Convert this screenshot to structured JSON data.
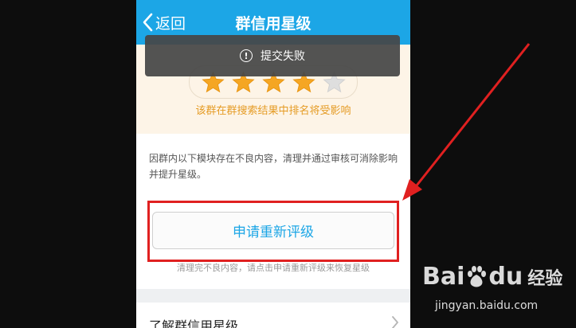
{
  "header": {
    "back_label": "返回",
    "title": "群信用星级"
  },
  "rating": {
    "stars_total": 5,
    "stars_filled": 4,
    "note": "该群在群搜索结果中排名将受影响",
    "star_color": "#f5a623",
    "star_empty_color": "#dedede"
  },
  "toast": {
    "message": "提交失败",
    "icon": "exclamation-circle-icon"
  },
  "content": {
    "description": "因群内以下模块存在不良内容，清理并通过审核可消除影响并提升星级。",
    "reapply_button": "申请重新评级",
    "hint": "清理完不良内容，请点击申请重新评级来恢复星级"
  },
  "learn_more": {
    "label": "了解群信用星级"
  },
  "watermark": {
    "brand_latin": "Bai",
    "brand_latin_2": "du",
    "brand_cn": "经验",
    "url": "jingyan.baidu.com"
  },
  "colors": {
    "accent": "#1ca6e6",
    "annotation": "#e02020"
  }
}
